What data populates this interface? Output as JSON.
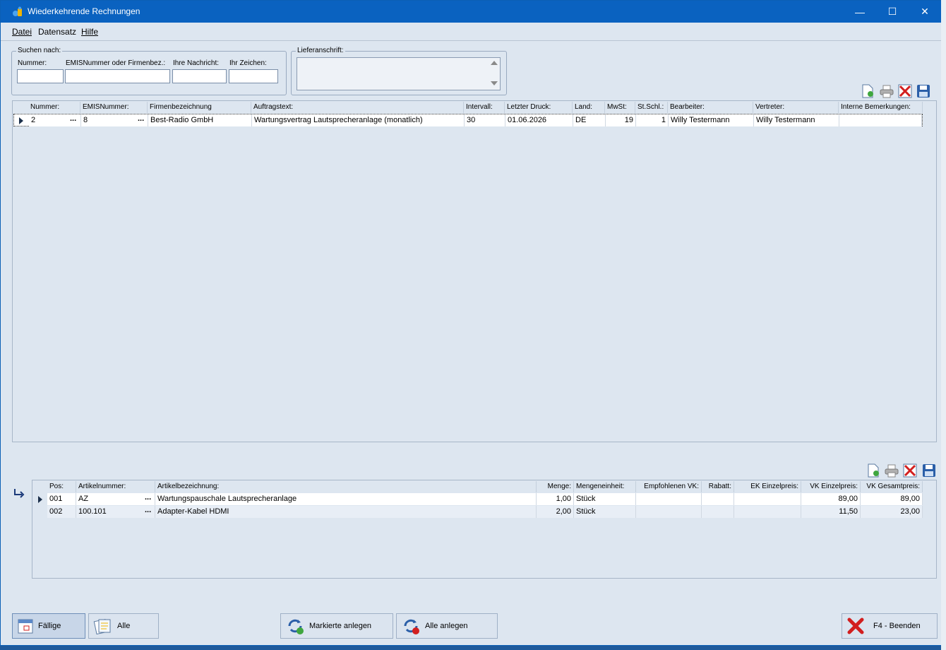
{
  "window": {
    "title": "Wiederkehrende Rechnungen",
    "controls": [
      "—",
      "☐",
      "✕"
    ]
  },
  "menu": {
    "items": [
      "Datei",
      "Datensatz",
      "Hilfe"
    ]
  },
  "search": {
    "group_label": "Suchen nach:",
    "fields": [
      {
        "label": "Nummer:",
        "value": ""
      },
      {
        "label": "EMISNummer oder Firmenbez.:",
        "value": ""
      },
      {
        "label": "Ihre Nachricht:",
        "value": ""
      },
      {
        "label": "Ihr Zeichen:",
        "value": ""
      }
    ]
  },
  "delivery": {
    "group_label": "Lieferanschrift:",
    "value": ""
  },
  "toolbar_icons": [
    "new-document-icon",
    "print-icon",
    "delete-icon",
    "save-icon"
  ],
  "invoices": {
    "columns": [
      "Nummer:",
      "EMISNummer:",
      "Firmenbezeichnung",
      "Auftragstext:",
      "Intervall:",
      "Letzter Druck:",
      "Land:",
      "MwSt:",
      "St.Schl.:",
      "Bearbeiter:",
      "Vertreter:",
      "Interne Bemerkungen:"
    ],
    "rows": [
      [
        "2",
        "8",
        "Best-Radio GmbH",
        "Wartungsvertrag Lautsprecheranlage (monatlich)",
        "30",
        "01.06.2026",
        "DE",
        "19",
        "1",
        "Willy Testermann",
        "Willy Testermann",
        ""
      ]
    ],
    "ellipsis": "..."
  },
  "positions": {
    "columns": [
      "Pos:",
      "Artikelnummer:",
      "Artikelbezeichnung:",
      "Menge:",
      "Mengeneinheit:",
      "Empfohlenen VK:",
      "Rabatt:",
      "EK Einzelpreis:",
      "VK Einzelpreis:",
      "VK Gesamtpreis:"
    ],
    "rows": [
      [
        "001",
        "AZ",
        "Wartungspauschale Lautsprecheranlage",
        "1,00",
        "Stück",
        "",
        "",
        "",
        "89,00",
        "89,00"
      ],
      [
        "002",
        "100.101",
        "Adapter-Kabel HDMI",
        "2,00",
        "Stück",
        "",
        "",
        "",
        "11,50",
        "23,00"
      ]
    ],
    "ellipsis": "..."
  },
  "buttons": {
    "faellige": "Fällige",
    "alle": "Alle",
    "markierte_anlegen": "Markierte anlegen",
    "alle_anlegen": "Alle anlegen",
    "beenden": "F4 - Beenden"
  },
  "colors": {
    "titlebar": "#0a62c0",
    "window_bg": "#dde6f0",
    "accent_red": "#d21f1f"
  }
}
